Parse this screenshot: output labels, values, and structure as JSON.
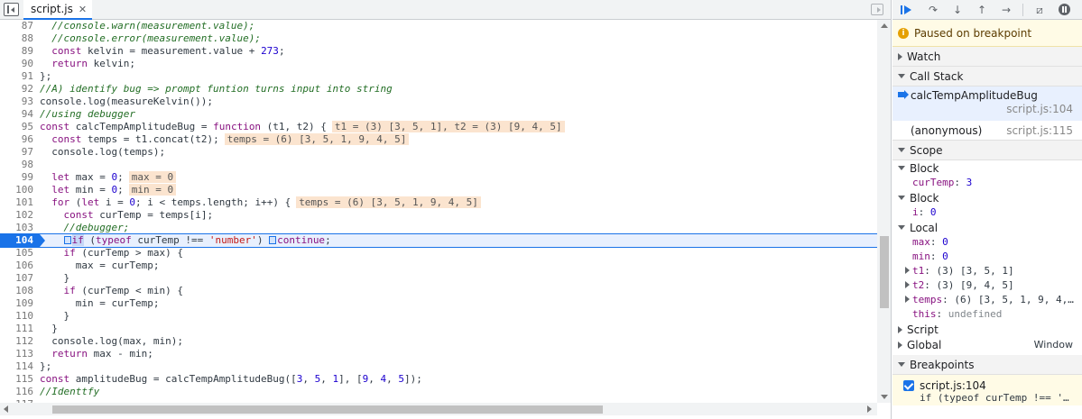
{
  "tab": {
    "filename": "script.js",
    "close": "✕"
  },
  "code_lines": [
    {
      "n": "87",
      "parts": [
        {
          "t": "  //console.warn(measurement.value);",
          "c": "cmt"
        }
      ]
    },
    {
      "n": "88",
      "parts": [
        {
          "t": "  //console.error(measurement.value);",
          "c": "cmt"
        }
      ]
    },
    {
      "n": "89",
      "parts": [
        {
          "t": "  ",
          "c": ""
        },
        {
          "t": "const",
          "c": "kw"
        },
        {
          "t": " kelvin = measurement.value + ",
          "c": ""
        },
        {
          "t": "273",
          "c": "num"
        },
        {
          "t": ";",
          "c": ""
        }
      ]
    },
    {
      "n": "90",
      "parts": [
        {
          "t": "  ",
          "c": ""
        },
        {
          "t": "return",
          "c": "kw"
        },
        {
          "t": " kelvin;",
          "c": ""
        }
      ]
    },
    {
      "n": "91",
      "parts": [
        {
          "t": "};",
          "c": ""
        }
      ]
    },
    {
      "n": "92",
      "parts": [
        {
          "t": "//A) identify bug => prompt funtion turns input into string",
          "c": "cmt"
        }
      ]
    },
    {
      "n": "93",
      "parts": [
        {
          "t": "console.log(measureKelvin());",
          "c": ""
        }
      ]
    },
    {
      "n": "94",
      "parts": [
        {
          "t": "//using debugger",
          "c": "cmt"
        }
      ]
    },
    {
      "n": "95",
      "parts": [
        {
          "t": "const",
          "c": "kw"
        },
        {
          "t": " calcTempAmplitudeBug = ",
          "c": ""
        },
        {
          "t": "function",
          "c": "kw"
        },
        {
          "t": " (t1, t2) {",
          "c": ""
        },
        {
          "t": "t1 = (3) [3, 5, 1], t2 = (3) [9, 4, 5]",
          "c": "inline-val"
        }
      ]
    },
    {
      "n": "96",
      "parts": [
        {
          "t": "  ",
          "c": ""
        },
        {
          "t": "const",
          "c": "kw"
        },
        {
          "t": " temps = t1.concat(t2);",
          "c": ""
        },
        {
          "t": "temps = (6) [3, 5, 1, 9, 4, 5]",
          "c": "inline-val"
        }
      ]
    },
    {
      "n": "97",
      "parts": [
        {
          "t": "  console.log(temps);",
          "c": ""
        }
      ]
    },
    {
      "n": "98",
      "parts": [
        {
          "t": "",
          "c": ""
        }
      ]
    },
    {
      "n": "99",
      "parts": [
        {
          "t": "  ",
          "c": ""
        },
        {
          "t": "let",
          "c": "kw"
        },
        {
          "t": " max = ",
          "c": ""
        },
        {
          "t": "0",
          "c": "num"
        },
        {
          "t": ";",
          "c": ""
        },
        {
          "t": "max = 0",
          "c": "inline-val"
        }
      ]
    },
    {
      "n": "100",
      "parts": [
        {
          "t": "  ",
          "c": ""
        },
        {
          "t": "let",
          "c": "kw"
        },
        {
          "t": " min = ",
          "c": ""
        },
        {
          "t": "0",
          "c": "num"
        },
        {
          "t": ";",
          "c": ""
        },
        {
          "t": "min = 0",
          "c": "inline-val"
        }
      ]
    },
    {
      "n": "101",
      "parts": [
        {
          "t": "  ",
          "c": ""
        },
        {
          "t": "for",
          "c": "kw"
        },
        {
          "t": " (",
          "c": ""
        },
        {
          "t": "let",
          "c": "kw"
        },
        {
          "t": " i = ",
          "c": ""
        },
        {
          "t": "0",
          "c": "num"
        },
        {
          "t": "; i < temps.length; i++) {",
          "c": ""
        },
        {
          "t": "temps = (6) [3, 5, 1, 9, 4, 5]",
          "c": "inline-val"
        }
      ]
    },
    {
      "n": "102",
      "parts": [
        {
          "t": "    ",
          "c": ""
        },
        {
          "t": "const",
          "c": "kw"
        },
        {
          "t": " curTemp = temps[i];",
          "c": ""
        }
      ]
    },
    {
      "n": "103",
      "parts": [
        {
          "t": "    //debugger;",
          "c": "cmt"
        }
      ]
    },
    {
      "n": "104",
      "exec": true,
      "parts": [
        {
          "t": "    ",
          "c": ""
        },
        {
          "t": "",
          "c": "bp-inline"
        },
        {
          "t": "if",
          "c": "kw hl-if"
        },
        {
          "t": " (",
          "c": ""
        },
        {
          "t": "typeof",
          "c": "kw"
        },
        {
          "t": " curTemp !== ",
          "c": ""
        },
        {
          "t": "'number'",
          "c": "str"
        },
        {
          "t": ") ",
          "c": ""
        },
        {
          "t": "",
          "c": "bp-inline"
        },
        {
          "t": "continue",
          "c": "kw"
        },
        {
          "t": ";",
          "c": ""
        }
      ]
    },
    {
      "n": "105",
      "parts": [
        {
          "t": "    ",
          "c": ""
        },
        {
          "t": "if",
          "c": "kw"
        },
        {
          "t": " (curTemp > max) {",
          "c": ""
        }
      ]
    },
    {
      "n": "106",
      "parts": [
        {
          "t": "      max = curTemp;",
          "c": ""
        }
      ]
    },
    {
      "n": "107",
      "parts": [
        {
          "t": "    }",
          "c": ""
        }
      ]
    },
    {
      "n": "108",
      "parts": [
        {
          "t": "    ",
          "c": ""
        },
        {
          "t": "if",
          "c": "kw"
        },
        {
          "t": " (curTemp < min) {",
          "c": ""
        }
      ]
    },
    {
      "n": "109",
      "parts": [
        {
          "t": "      min = curTemp;",
          "c": ""
        }
      ]
    },
    {
      "n": "110",
      "parts": [
        {
          "t": "    }",
          "c": ""
        }
      ]
    },
    {
      "n": "111",
      "parts": [
        {
          "t": "  }",
          "c": ""
        }
      ]
    },
    {
      "n": "112",
      "parts": [
        {
          "t": "  console.log(max, min);",
          "c": ""
        }
      ]
    },
    {
      "n": "113",
      "parts": [
        {
          "t": "  ",
          "c": ""
        },
        {
          "t": "return",
          "c": "kw"
        },
        {
          "t": " max - min;",
          "c": ""
        }
      ]
    },
    {
      "n": "114",
      "parts": [
        {
          "t": "};",
          "c": ""
        }
      ]
    },
    {
      "n": "115",
      "parts": [
        {
          "t": "const",
          "c": "kw"
        },
        {
          "t": " amplitudeBug = calcTempAmplitudeBug([",
          "c": ""
        },
        {
          "t": "3",
          "c": "num"
        },
        {
          "t": ", ",
          "c": ""
        },
        {
          "t": "5",
          "c": "num"
        },
        {
          "t": ", ",
          "c": ""
        },
        {
          "t": "1",
          "c": "num"
        },
        {
          "t": "], [",
          "c": ""
        },
        {
          "t": "9",
          "c": "num"
        },
        {
          "t": ", ",
          "c": ""
        },
        {
          "t": "4",
          "c": "num"
        },
        {
          "t": ", ",
          "c": ""
        },
        {
          "t": "5",
          "c": "num"
        },
        {
          "t": "]);",
          "c": ""
        }
      ]
    },
    {
      "n": "116",
      "parts": [
        {
          "t": "//Identtfy",
          "c": "cmt"
        }
      ]
    },
    {
      "n": "117",
      "parts": [
        {
          "t": "",
          "c": ""
        }
      ]
    }
  ],
  "debugger": {
    "paused_text": "Paused on breakpoint",
    "watch_label": "Watch",
    "call_stack_label": "Call Stack",
    "frames": [
      {
        "name": "calcTempAmplitudeBug",
        "location": "script.js:104"
      },
      {
        "name": "(anonymous)",
        "location": "script.js:115"
      }
    ],
    "scope_label": "Scope",
    "block1_label": "Block",
    "block1_vars": [
      {
        "name": "curTemp",
        "value": "3"
      }
    ],
    "block2_label": "Block",
    "block2_vars": [
      {
        "name": "i",
        "value": "0"
      }
    ],
    "local_label": "Local",
    "local_vars": [
      {
        "name": "max",
        "value": "0"
      },
      {
        "name": "min",
        "value": "0"
      }
    ],
    "local_objects": [
      {
        "name": "t1",
        "value": "(3) [3, 5, 1]"
      },
      {
        "name": "t2",
        "value": "(3) [9, 4, 5]"
      },
      {
        "name": "temps",
        "value": "(6) [3, 5, 1, 9, 4,…"
      }
    ],
    "this_var": {
      "name": "this",
      "value": "undefined"
    },
    "script_label": "Script",
    "global_label": "Global",
    "global_value": "Window",
    "breakpoints_label": "Breakpoints",
    "breakpoint": {
      "location": "script.js:104",
      "code": "if (typeof curTemp !== '…"
    }
  },
  "colors": {
    "accent": "#1a73e8",
    "paused_bg": "#fffbe6",
    "inline_value_bg": "#fbe4cf"
  }
}
